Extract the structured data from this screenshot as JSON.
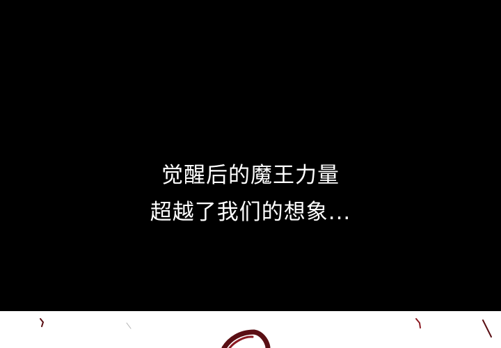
{
  "caption": {
    "line1": "觉醒后的魔王力量",
    "line2": "超越了我们的想象..."
  },
  "colors": {
    "background": "#000000",
    "text": "#ffffff",
    "lower_panel": "#ffffff",
    "sketch_red": "#5a0f14"
  },
  "icons": {
    "lower_panel_art": "red-sketch-marks"
  }
}
